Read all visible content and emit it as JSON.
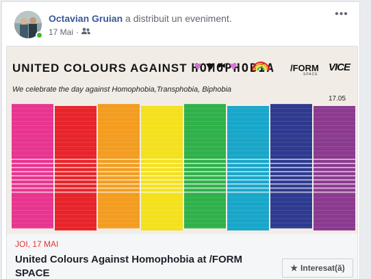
{
  "post": {
    "author_name": "Octavian Gruian",
    "action_text": "a distribuit un eveniment.",
    "timestamp": "17 Mai",
    "audience_icon": "friends-icon",
    "more_icon": "more-options-icon"
  },
  "banner": {
    "title_part1": "UNITED COLOURS AGAINST ",
    "title_part2": "HOMOPHOBIA",
    "subtitle": "We celebrate the day against Homophobia,Transphobia, Biphobia",
    "date": "17.05",
    "form_logo": "/FORM",
    "form_sub": "SPACE",
    "vice_logo": "VICE",
    "stripe_colors": [
      "#e8348f",
      "#e8232a",
      "#f39c1f",
      "#f4e11c",
      "#2fb14a",
      "#18a6c9",
      "#2e3a8f",
      "#8b3a8f"
    ]
  },
  "event": {
    "date_label": "JOI, 17 MAI",
    "title": "United Colours Against Homophobia at /FORM SPACE",
    "interested_label": "Interesat(ă)",
    "interested_icon": "star-icon"
  }
}
